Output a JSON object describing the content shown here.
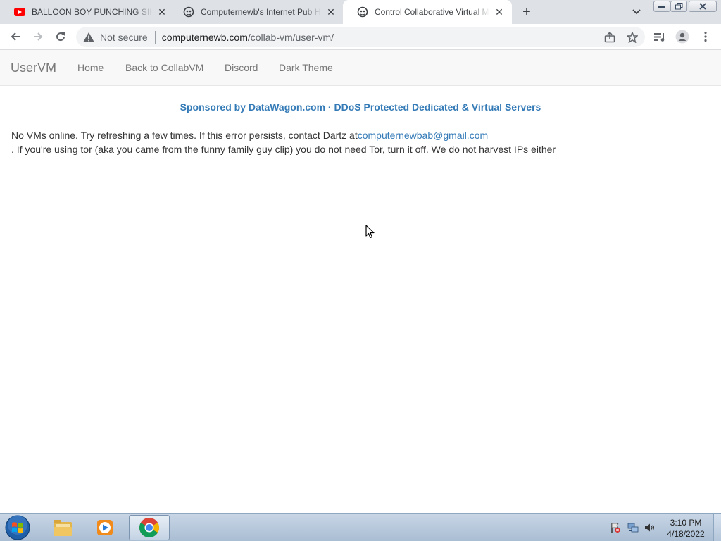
{
  "browser": {
    "tabs": [
      {
        "title": "BALLOON BOY PUNCHING SIMULATOR",
        "favicon": "youtube-icon",
        "active": false
      },
      {
        "title": "Computernewb's Internet Pub Hub",
        "favicon": "computernewb-icon",
        "active": false
      },
      {
        "title": "Control Collaborative Virtual Machines",
        "favicon": "computernewb-icon",
        "active": true
      }
    ],
    "omnibox": {
      "security_label": "Not secure",
      "url_host": "computernewb.com",
      "url_path": "/collab-vm/user-vm/"
    }
  },
  "page": {
    "navbar": {
      "brand": "UserVM",
      "links": [
        "Home",
        "Back to CollabVM",
        "Discord",
        "Dark Theme"
      ]
    },
    "sponsor": "Sponsored by DataWagon.com · DDoS Protected Dedicated & Virtual Servers",
    "message_line1": "No VMs online. Try refreshing a few times. If this error persists, contact Dartz at",
    "email": "computernewbab@gmail.com",
    "message_line2": ". If you're using tor (aka you came from the funny family guy clip) you do not need Tor, turn it off. We do not harvest IPs either"
  },
  "taskbar": {
    "items": [
      "explorer-icon",
      "media-player-icon",
      "chrome-icon"
    ],
    "clock_time": "3:10 PM",
    "clock_date": "4/18/2022"
  },
  "colors": {
    "link": "#337ab7",
    "tabstrip": "#dee1e6",
    "navbar": "#f8f8f8"
  }
}
